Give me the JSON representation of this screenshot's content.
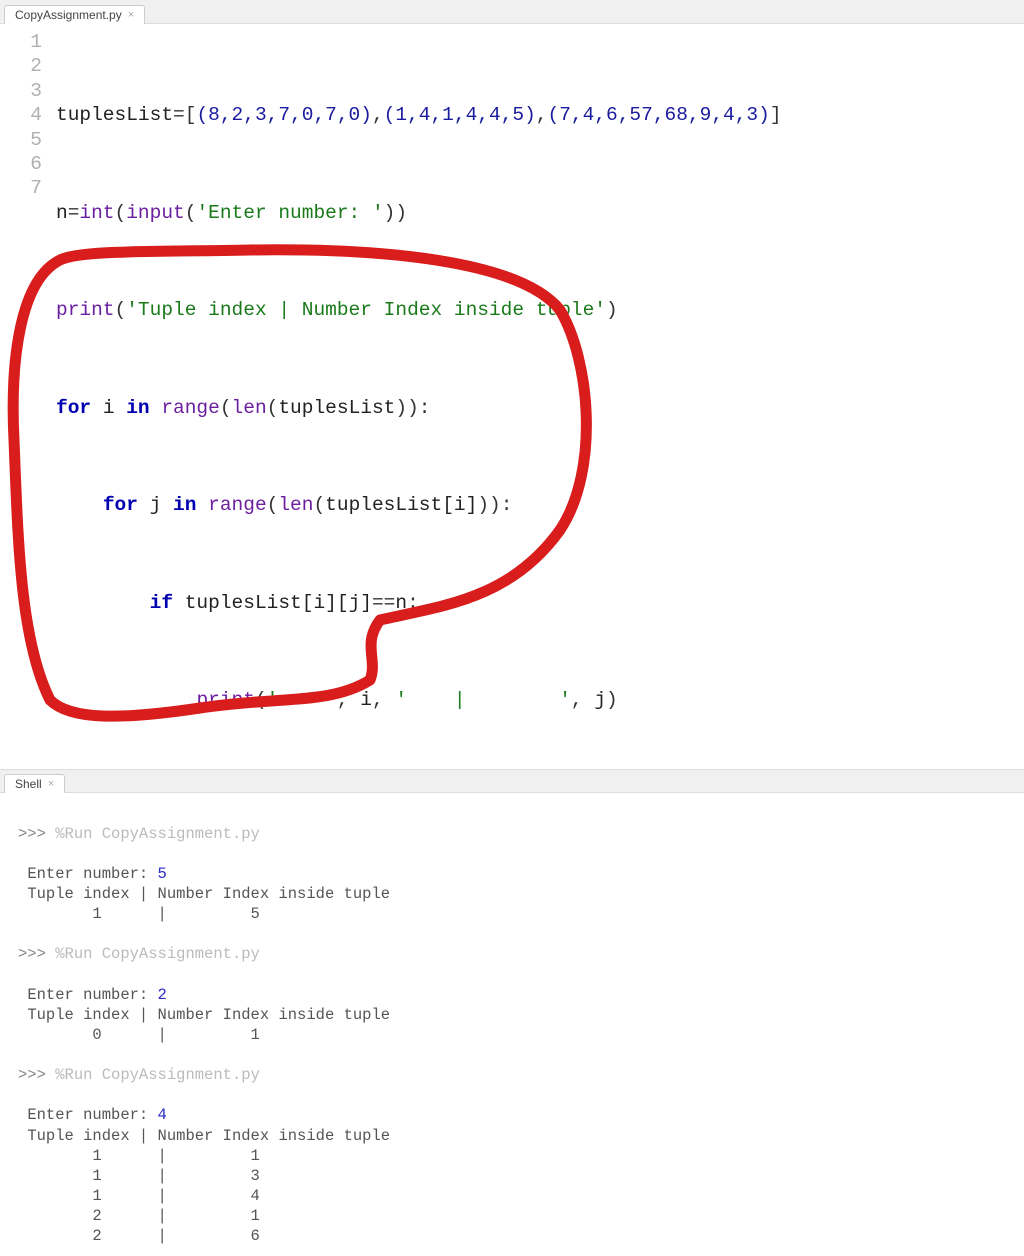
{
  "editor_tab": {
    "label": "CopyAssignment.py"
  },
  "shell_tab": {
    "label": "Shell"
  },
  "code": {
    "line_numbers": [
      "1",
      "2",
      "3",
      "4",
      "5",
      "6",
      "7"
    ],
    "lines_raw": [
      "tuplesList=[(8,2,3,7,0,7,0),(1,4,1,4,4,5),(7,4,6,57,68,9,4,3)]",
      "n=int(input('Enter number: '))",
      "print('Tuple index | Number Index inside tuple')",
      "for i in range(len(tuplesList)):",
      "    for j in range(len(tuplesList[i])):",
      "        if tuplesList[i][j]==n:",
      "            print('    ', i, '    |        ', j)"
    ],
    "tok": {
      "tuplesList": "tuplesList",
      "eq": "=",
      "lbracket": "[",
      "rbracket": "]",
      "tuple1": "(8,2,3,7,0,7,0)",
      "tuple2": "(1,4,1,4,4,5)",
      "tuple3": "(7,4,6,57,68,9,4,3)",
      "comma": ",",
      "n": "n",
      "int": "int",
      "input": "input",
      "lp": "(",
      "rp": ")",
      "str_enter": "'Enter number: '",
      "print": "print",
      "str_header": "'Tuple index | Number Index inside tuple'",
      "for": "for",
      "i": "i",
      "j": "j",
      "in": "in",
      "range": "range",
      "len": "len",
      "colon": ":",
      "if": "if",
      "eqeq": "==",
      "idx_i": "[i]",
      "idx_j": "[j]",
      "str_sp1": "'    '",
      "str_sp2": "'    |        '",
      "ind1": "    ",
      "ind2": "        ",
      "ind3": "            "
    }
  },
  "shell": {
    "prompt": ">>>",
    "run_cmd": "%Run CopyAssignment.py",
    "runs": [
      {
        "enter_label": "Enter number:",
        "enter_value": "5",
        "header": "Tuple index | Number Index inside tuple",
        "rows": [
          "       1      |         5"
        ]
      },
      {
        "enter_label": "Enter number:",
        "enter_value": "2",
        "header": "Tuple index | Number Index inside tuple",
        "rows": [
          "       0      |         1"
        ]
      },
      {
        "enter_label": "Enter number:",
        "enter_value": "4",
        "header": "Tuple index | Number Index inside tuple",
        "rows": [
          "       1      |         1",
          "       1      |         3",
          "       1      |         4",
          "       2      |         1",
          "       2      |         6"
        ]
      }
    ]
  },
  "annotation_color": "#d91c1c"
}
